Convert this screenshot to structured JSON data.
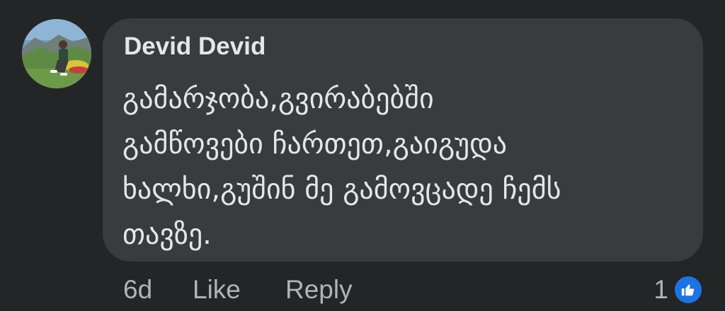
{
  "comment": {
    "author": "Devid Devid",
    "text": "გამარჯობა,გვირაბებში\nგამწოვები ჩართეთ,გაიგუდა\nხალხი,გუშინ მე გამოვცადე ჩემს\nთავზე.",
    "avatar_icon": "profile-photo"
  },
  "actions": {
    "time": "6d",
    "like": "Like",
    "reply": "Reply"
  },
  "reactions": {
    "count": "1",
    "icon": "like-icon",
    "color": "#1b74e4"
  },
  "colors": {
    "background": "#242526",
    "bubble": "#3a3b3c",
    "text_primary": "#e4e6eb",
    "text_secondary": "#b0b3b8"
  }
}
